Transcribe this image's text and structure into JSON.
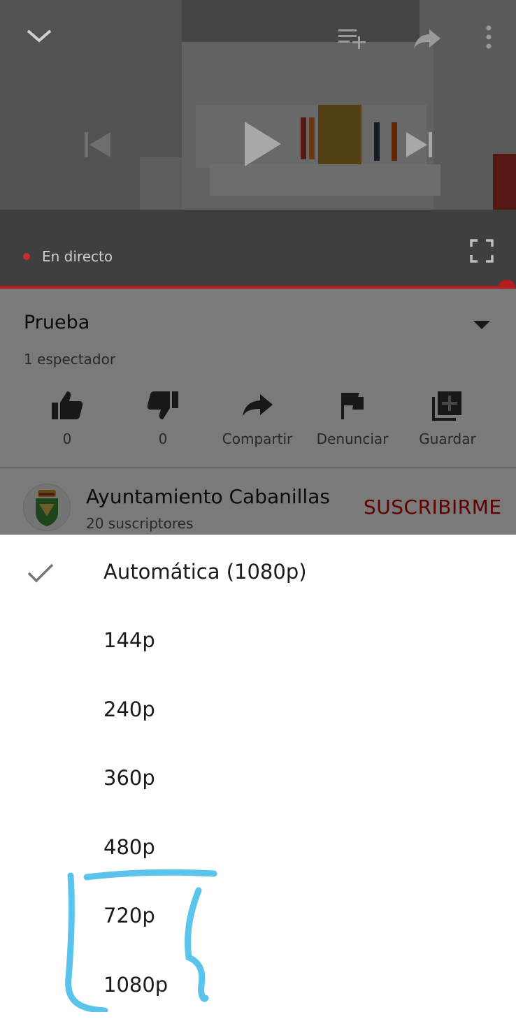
{
  "player": {
    "live_label": "En directo",
    "icons": [
      "chevron-down-icon",
      "add-to-playlist-icon",
      "share-icon",
      "more-vert-icon",
      "skip-previous-icon",
      "play-icon",
      "skip-next-icon",
      "fullscreen-icon"
    ],
    "progress_color": "#b71c1c"
  },
  "video": {
    "title": "Prueba",
    "viewers": "1 espectador"
  },
  "actions": [
    {
      "label": "0",
      "icon": "thumb-up-icon"
    },
    {
      "label": "0",
      "icon": "thumb-down-icon"
    },
    {
      "label": "Compartir",
      "icon": "share-icon"
    },
    {
      "label": "Denunciar",
      "icon": "flag-icon"
    },
    {
      "label": "Guardar",
      "icon": "add-to-library-icon"
    }
  ],
  "channel": {
    "name": "Ayuntamiento Cabanillas",
    "subscribers": "20 suscriptores",
    "subscribe_label": "SUSCRIBIRME",
    "subscribe_color": "#cc0000"
  },
  "quality_menu": {
    "selected": "Automática (1080p)",
    "options": [
      {
        "label": "Automática (1080p)",
        "checked": true
      },
      {
        "label": "144p",
        "checked": false
      },
      {
        "label": "240p",
        "checked": false
      },
      {
        "label": "360p",
        "checked": false
      },
      {
        "label": "480p",
        "checked": false
      },
      {
        "label": "720p",
        "checked": false
      },
      {
        "label": "1080p",
        "checked": false
      }
    ]
  },
  "annotation": {
    "color": "#5bc4ec"
  }
}
